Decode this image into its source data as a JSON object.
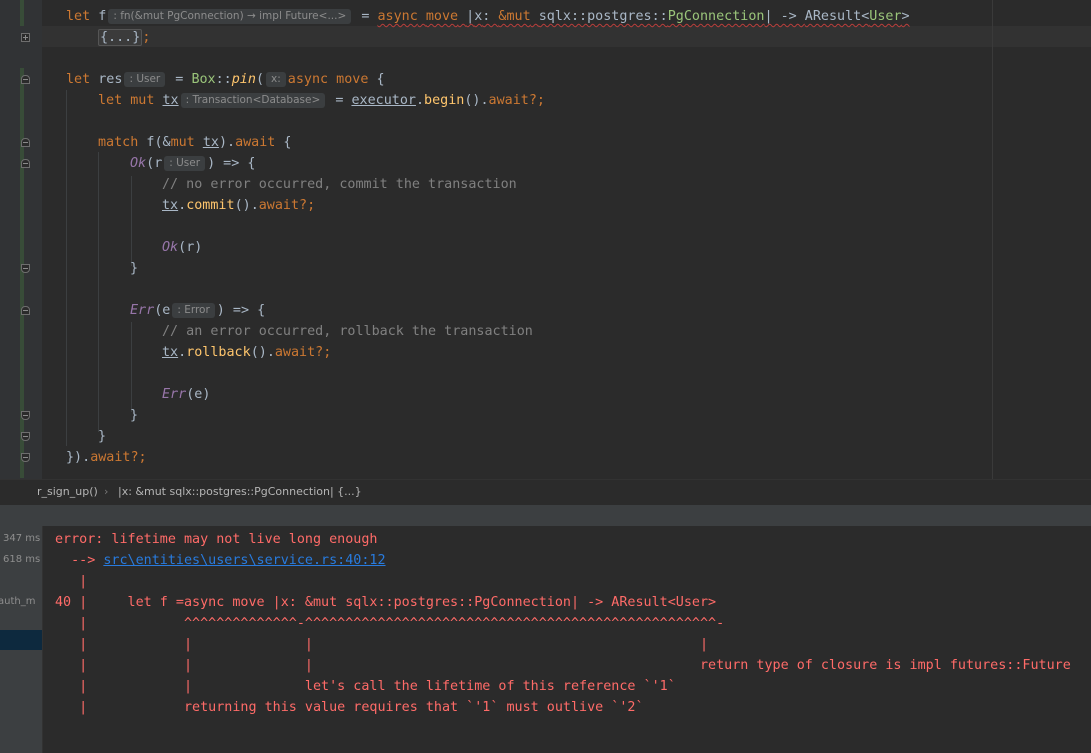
{
  "editor": {
    "line1": {
      "let": "let",
      "f": "f",
      "hint": ": fn(&mut PgConnection) → impl Future<...>",
      "eq": " = ",
      "async": "async",
      "move": "move",
      "pipe_open": "|",
      "x": "x",
      "colon": ": ",
      "mut_ref": "&mut",
      "path": "sqlx::postgres::",
      "pgconn": "PgConnection",
      "pipe_close": "| -> ",
      "aresult": "AResult",
      "lt": "<",
      "user": "User",
      "gt": ">"
    },
    "line2": {
      "folded": "{...}",
      "semi": ";"
    },
    "line3": {
      "let": "let",
      "res": "res",
      "hint": ": User",
      "eq": " = ",
      "box": "Box",
      "sep": "::",
      "pin": "pin",
      "paren": "(",
      "hint2": "x:",
      "async": "async",
      "move": "move",
      "brace": "{"
    },
    "line4": {
      "let": "let",
      "mut": "mut",
      "tx": "tx",
      "hint": ": Transaction<Database>",
      "eq": " = ",
      "executor": "executor",
      "dot": ".",
      "begin": "begin",
      "parens": "()",
      "dot2": ".",
      "await": "await?;"
    },
    "line5": {
      "match": "match",
      "f": "f",
      "open": "(&",
      "mut": "mut",
      "tx": "tx",
      "close": ").",
      "await": "await",
      "brace": " {"
    },
    "line6": {
      "ok": "Ok",
      "open": "(",
      "r": "r",
      "hint": ": User",
      "close": ") => {"
    },
    "line7": {
      "comment": "// no error occurred, commit the transaction"
    },
    "line8": {
      "tx": "tx",
      "dot": ".",
      "commit": "commit",
      "parens": "()",
      "dot2": ".",
      "await": "await?;"
    },
    "line9": {
      "ok": "Ok",
      "open": "(",
      "r": "r",
      "close": ")"
    },
    "line10": {
      "brace": "}"
    },
    "line11": {
      "err": "Err",
      "open": "(",
      "e": "e",
      "hint": ": Error",
      "close": ") => {"
    },
    "line12": {
      "comment": "// an error occurred, rollback the transaction"
    },
    "line13": {
      "tx": "tx",
      "dot": ".",
      "rollback": "rollback",
      "parens": "()",
      "dot2": ".",
      "await": "await?;"
    },
    "line14": {
      "err": "Err",
      "open": "(",
      "e": "e",
      "close": ")"
    },
    "line15": {
      "brace": "}"
    },
    "line16": {
      "brace": "}"
    },
    "line17": {
      "close": "}).",
      "await": "await?;"
    }
  },
  "breadcrumb": {
    "item1": "r_sign_up()",
    "sep": "›",
    "item2": "|x: &mut sqlx::postgres::PgConnection| {...}"
  },
  "run_tree": {
    "t1": "347 ms",
    "t2": "618 ms",
    "t3": "auth_m"
  },
  "console": {
    "l1": "error: lifetime may not live long enough",
    "l2_prefix": "  --> ",
    "l2_link": "src\\entities\\users\\service.rs:40:12",
    "l3": "   |",
    "l4": "40 |     let f =async move |x: &mut sqlx::postgres::PgConnection| -> AResult<User>",
    "l5": "   |            ^^^^^^^^^^^^^^-^^^^^^^^^^^^^^^^^^^^^^^^^^^^^^^^^^^^^^^^^^^^^^^^^^^-",
    "l6": "   |            |              |                                                |",
    "l7": "   |            |              |                                                return type of closure is impl futures::Future",
    "l8": "   |            |              let's call the lifetime of this reference `'1`",
    "l9": "   |            returning this value requires that `'1` must outlive `'2`"
  },
  "colors": {
    "background": "#2b2b2b",
    "keyword": "#cc7832",
    "function": "#ffc66d",
    "type": "#9ac57a",
    "comment": "#808080",
    "error": "#ff6b68",
    "link": "#287bde"
  }
}
